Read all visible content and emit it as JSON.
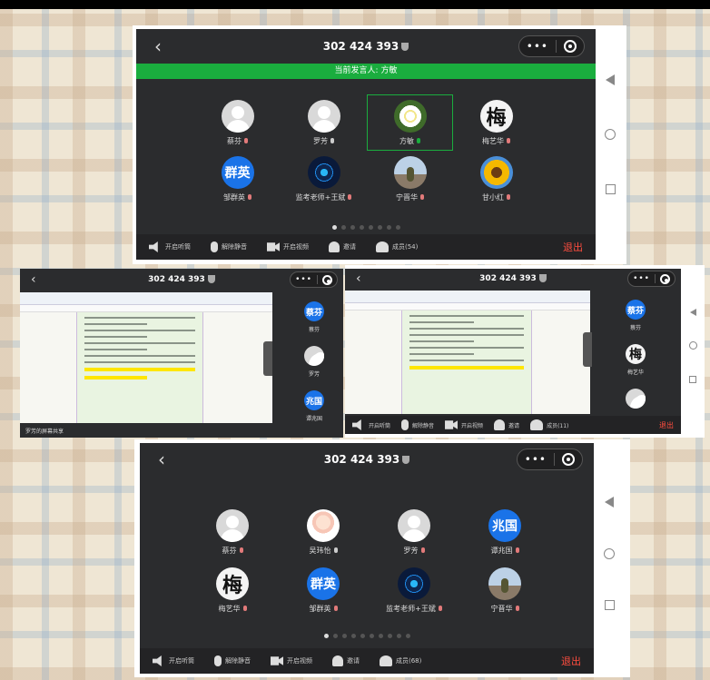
{
  "meeting_id": "302 424 393",
  "speaker_banner": "当前发言人: 方敏",
  "toolbar": {
    "speaker": "开启听筒",
    "unmute": "解除静音",
    "video": "开启视频",
    "invite": "邀请",
    "members_1": "成员(54)",
    "members_2": "成员(11)",
    "members_3": "成员(68)",
    "exit": "退出"
  },
  "screen1": {
    "participants": [
      {
        "name": "蔡芬",
        "avatar": "gray",
        "mic": "off"
      },
      {
        "name": "罗芳",
        "avatar": "gray",
        "mic": "neutral"
      },
      {
        "name": "方敏",
        "avatar": "flower-white",
        "mic": "on",
        "active": true
      },
      {
        "name": "梅艺华",
        "avatar": "calligraphy",
        "mic": "off",
        "avatar_text": "梅"
      },
      {
        "name": "邹群英",
        "avatar": "blue",
        "mic": "off",
        "avatar_text": "群英"
      },
      {
        "name": "监考老师+王斌",
        "avatar": "tech",
        "mic": "off"
      },
      {
        "name": "宁晋华",
        "avatar": "person",
        "mic": "off"
      },
      {
        "name": "甘小红",
        "avatar": "flower-yellow",
        "mic": "off"
      }
    ]
  },
  "screen2": {
    "side": [
      {
        "name": "蔡芬",
        "avatar": "blue",
        "avatar_text": "蔡芬"
      },
      {
        "name": "罗芳",
        "avatar": "gray"
      },
      {
        "name": "谭兆国",
        "avatar": "blue",
        "avatar_text": "兆国"
      }
    ],
    "caption": "罗芳的屏幕共享"
  },
  "screen3": {
    "side": [
      {
        "name": "蔡芬",
        "avatar": "blue",
        "avatar_text": "蔡芬"
      },
      {
        "name": "梅艺华",
        "avatar": "calligraphy",
        "avatar_text": "梅"
      },
      {
        "name": "",
        "avatar": "gray"
      }
    ]
  },
  "screen4": {
    "participants": [
      {
        "name": "蔡芬",
        "avatar": "gray",
        "mic": "off"
      },
      {
        "name": "吴玮怡",
        "avatar": "anime",
        "mic": "neutral"
      },
      {
        "name": "罗芳",
        "avatar": "gray",
        "mic": "off"
      },
      {
        "name": "谭兆国",
        "avatar": "blue",
        "mic": "off",
        "avatar_text": "兆国"
      },
      {
        "name": "梅艺华",
        "avatar": "calligraphy",
        "mic": "off",
        "avatar_text": "梅"
      },
      {
        "name": "邹群英",
        "avatar": "blue",
        "mic": "off",
        "avatar_text": "群英"
      },
      {
        "name": "监考老师+王斌",
        "avatar": "tech",
        "mic": "off"
      },
      {
        "name": "宁晋华",
        "avatar": "person",
        "mic": "off"
      }
    ]
  },
  "colors": {
    "accent_green": "#1aad3e",
    "exit_red": "#ff4d3f",
    "avatar_blue": "#1a73e8"
  }
}
